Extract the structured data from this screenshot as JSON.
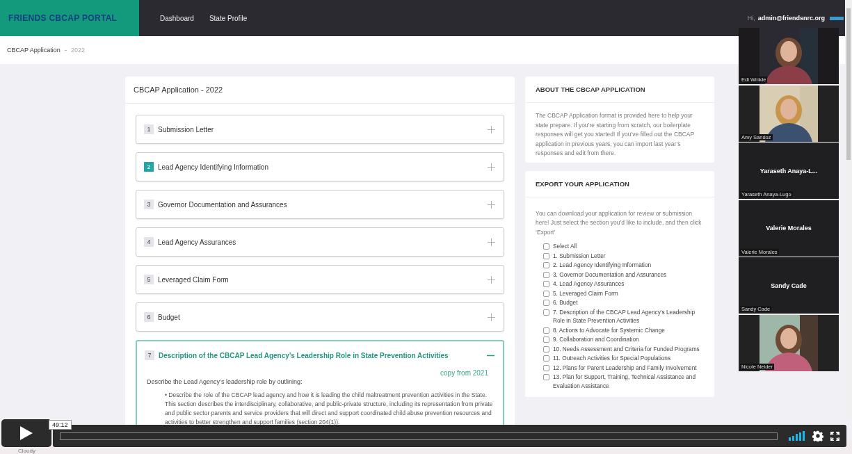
{
  "header": {
    "logo": "FRIENDS CBCAP PORTAL",
    "nav": [
      {
        "label": "Dashboard"
      },
      {
        "label": "State Profile"
      }
    ],
    "greeting": "Hi,",
    "user": "admin@friendsnrc.org"
  },
  "breadcrumb": [
    "CBCAP Application",
    "2022"
  ],
  "application": {
    "title": "CBCAP Application - 2022",
    "sections": [
      {
        "number": "1",
        "title": "Submission Letter",
        "expanded": false,
        "highlighted": false
      },
      {
        "number": "2",
        "title": "Lead Agency Identifying Information",
        "expanded": false,
        "highlighted": true
      },
      {
        "number": "3",
        "title": "Governor Documentation and Assurances",
        "expanded": false,
        "highlighted": false
      },
      {
        "number": "4",
        "title": "Lead Agency Assurances",
        "expanded": false,
        "highlighted": false
      },
      {
        "number": "5",
        "title": "Leveraged Claim Form",
        "expanded": false,
        "highlighted": false
      },
      {
        "number": "6",
        "title": "Budget",
        "expanded": false,
        "highlighted": false
      },
      {
        "number": "7",
        "title": "Description of the CBCAP Lead Agency’s Leadership Role in State Prevention Activities",
        "expanded": true,
        "highlighted": false,
        "copy_link": "copy from 2021",
        "prompt": "Describe the Lead Agency’s leadership role by outlining:",
        "bullets": [
          "• Describe the role of the CBCAP lead agency and how it is leading the child maltreatment prevention activities in the State. This section describes the interdisciplinary, collaborative, and public-private structure, including its representation from private and public sector parents and service providers that will direct and support coordinated child abuse prevention resources and activities to better strengthen and support families (section 204(1))."
        ]
      }
    ]
  },
  "about": {
    "title": "ABOUT THE CBCAP APPLICATION",
    "text": "The CBCAP Application format is provided here to help your state prepare. If you’re starting from scratch, our boilerplate responses will get you started! If you’ve filled out the CBCAP application in previous years, you can import last year’s responses and edit from there."
  },
  "export": {
    "title": "EXPORT YOUR APPLICATION",
    "text": "You can download your application for review or submission here! Just select the section you’d like to include, and then click ‘Export’",
    "options": [
      {
        "label": "Select All",
        "checked": false
      },
      {
        "label": "1. Submission Letter",
        "checked": false
      },
      {
        "label": "2. Lead Agency Identifying Information",
        "checked": false
      },
      {
        "label": "3. Governor Documentation and Assurances",
        "checked": false
      },
      {
        "label": "4. Lead Agency Assurances",
        "checked": false
      },
      {
        "label": "5. Leveraged Claim Form",
        "checked": false
      },
      {
        "label": "6. Budget",
        "checked": false
      },
      {
        "label": "7. Description of the CBCAP Lead Agency’s Leadership Role in State Prevention Activities",
        "checked": false
      },
      {
        "label": "8. Actions to Advocate for Systemic Change",
        "checked": false
      },
      {
        "label": "9. Collaboration and Coordination",
        "checked": false
      },
      {
        "label": "10. Needs Assessment and Criteria for Funded Programs",
        "checked": false
      },
      {
        "label": "11. Outreach Activities for Special Populations",
        "checked": false
      },
      {
        "label": "12. Plans for Parent Leadership and Family Involvement",
        "checked": false
      },
      {
        "label": "13. Plan for Support, Training, Technical Assistance and Evaluation Assistance",
        "checked": false
      }
    ]
  },
  "participants": [
    {
      "kind": "video",
      "name": "Edi Winkle"
    },
    {
      "kind": "video",
      "name": "Amy Sandoz"
    },
    {
      "kind": "avatar",
      "display": "Yaraseth  Anaya-L...",
      "name": "Yaraseth Anaya-Lugo"
    },
    {
      "kind": "avatar",
      "display": "Valerie Morales",
      "name": "Valerie Morales"
    },
    {
      "kind": "avatar",
      "display": "Sandy Cade",
      "name": "Sandy Cade"
    },
    {
      "kind": "video",
      "name": "Nicole Neider"
    }
  ],
  "player": {
    "time": "49:12"
  },
  "taskbar": {
    "weather": "Cloudy"
  }
}
